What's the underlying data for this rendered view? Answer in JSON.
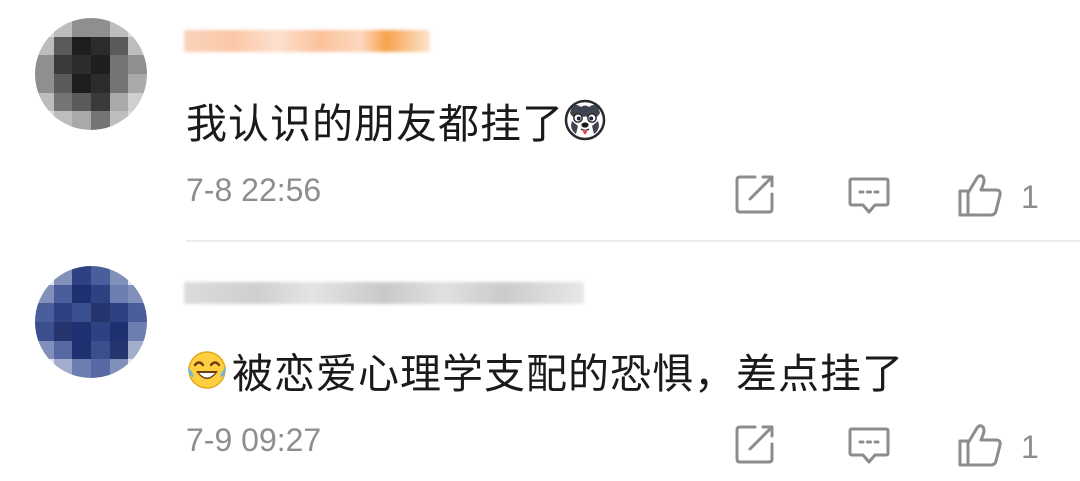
{
  "comments": [
    {
      "text": "我认识的朋友都挂了",
      "leading_emoji": "",
      "trailing_emoji": "husky-dog-emoji",
      "time": "7-8 22:56",
      "likes": "1",
      "avatar_blurred": true,
      "username_blurred": true,
      "avatar_colors": [
        "#dadada",
        "#bdbdbd",
        "#8f8f8f",
        "#5a5a5a",
        "#3a3a3a",
        "#1e1e1e",
        "#2c2c2c",
        "#747474",
        "#a9a9a9",
        "#cfcfcf"
      ]
    },
    {
      "text": "被恋爱心理学支配的恐惧，差点挂了",
      "leading_emoji": "laughing-tears-emoji",
      "trailing_emoji": "",
      "time": "7-9 09:27",
      "likes": "1",
      "avatar_blurred": true,
      "username_blurred": true,
      "avatar_colors": [
        "#e3e6ef",
        "#8090bb",
        "#4a5e9c",
        "#2d4183",
        "#1f3070",
        "#3b4f8f",
        "#6d7fb0",
        "#a3aecd",
        "#26356e",
        "#5768a3"
      ]
    }
  ],
  "icons": {
    "share": "edit-share-icon",
    "comment": "comment-bubble-icon",
    "like": "thumbs-up-icon"
  },
  "colors": {
    "text": "#1a1a1a",
    "meta": "#8e8e8e",
    "divider": "#ececec",
    "icon": "#8c8c8c"
  }
}
